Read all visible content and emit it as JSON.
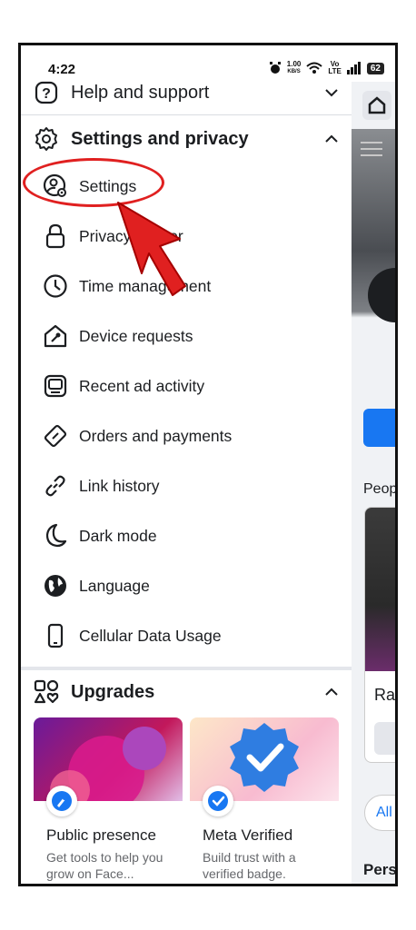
{
  "status_bar": {
    "time": "4:22",
    "net_speed_top": "1.00",
    "net_speed_bottom": "KB/S",
    "volte_top": "Vo",
    "volte_bottom": "LTE",
    "battery": "62"
  },
  "menu": {
    "help": {
      "label": "Help and support",
      "icon": "question-icon"
    },
    "settings_privacy": {
      "label": "Settings and privacy",
      "icon": "gear-icon"
    },
    "items": [
      {
        "label": "Settings",
        "icon": "user-gear-icon"
      },
      {
        "label": "Privacy Center",
        "icon": "lock-icon"
      },
      {
        "label": "Time management",
        "icon": "clock-icon"
      },
      {
        "label": "Device requests",
        "icon": "house-key-icon"
      },
      {
        "label": "Recent ad activity",
        "icon": "monitor-icon"
      },
      {
        "label": "Orders and payments",
        "icon": "tag-icon"
      },
      {
        "label": "Link history",
        "icon": "link-icon"
      },
      {
        "label": "Dark mode",
        "icon": "moon-icon"
      },
      {
        "label": "Language",
        "icon": "globe-icon"
      },
      {
        "label": "Cellular Data Usage",
        "icon": "phone-icon"
      }
    ],
    "upgrades": {
      "label": "Upgrades",
      "icon": "shapes-icon",
      "cards": [
        {
          "title": "Public presence",
          "desc": "Get tools to help you grow on Face...",
          "icon": "rocket-icon"
        },
        {
          "title": "Meta Verified",
          "desc": "Build trust with a verified badge.",
          "icon": "verified-badge-icon"
        }
      ]
    }
  },
  "background_panel": {
    "text_peop": "Peop",
    "text_ra": "Ra",
    "pill_all": "All",
    "text_pers": "Pers"
  },
  "colors": {
    "accent": "#1877f2",
    "annotation_red": "#e02020",
    "text": "#1c1e21",
    "subtext": "#65676b"
  }
}
